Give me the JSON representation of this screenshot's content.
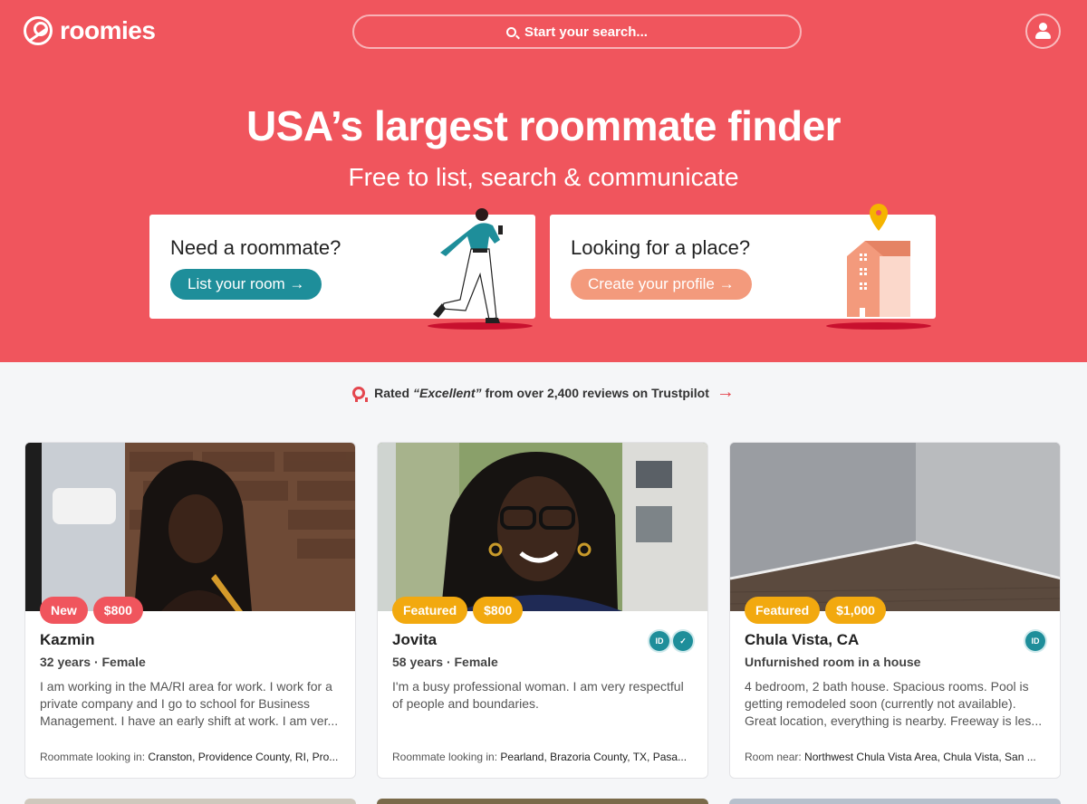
{
  "header": {
    "logo_text": "roomies",
    "search_placeholder": "Start your search..."
  },
  "hero": {
    "title": "USA’s largest roommate finder",
    "subtitle": "Free to list, search & communicate",
    "cta_room": {
      "title": "Need a roommate?",
      "button": "List your room →"
    },
    "cta_place": {
      "title": "Looking for a place?",
      "button": "Create your profile →"
    }
  },
  "trust": {
    "prefix": "Rated",
    "rating": "“Excellent”",
    "suffix": "from over 2,400 reviews on Trustpilot",
    "arrow": "→"
  },
  "cards": [
    {
      "badges": [
        "New",
        "$800"
      ],
      "name": "Kazmin",
      "meta": "32 years · Female",
      "description": "I am working in the MA/RI area for work. I work for a private company and I go to school for Business Management. I have an early shift at work. I am ver...",
      "foot_label": "Roommate looking in:",
      "foot_value": "Cranston, Providence County, RI, Pro..."
    },
    {
      "badges": [
        "Featured",
        "$800"
      ],
      "name": "Jovita",
      "meta": "58 years · Female",
      "description": "I'm a busy professional woman. I am very respectful of people and boundaries.",
      "foot_label": "Roommate looking in:",
      "foot_value": "Pearland, Brazoria County, TX, Pasa...",
      "verify": [
        "ID",
        "✓"
      ]
    },
    {
      "badges": [
        "Featured",
        "$1,000"
      ],
      "name": "Chula Vista, CA",
      "meta": "Unfurnished room in a house",
      "description": "4 bedroom, 2 bath house. Spacious rooms. Pool is getting remodeled soon (currently not available). Great location, everything is nearby. Freeway is les...",
      "foot_label": "Room near:",
      "foot_value": "Northwest Chula Vista Area, Chula Vista, San ...",
      "verify": [
        "ID"
      ]
    }
  ],
  "colors": {
    "brand": "#f0555d",
    "teal": "#1e8e9a",
    "peach": "#f39a7c",
    "gold": "#f2a90f"
  }
}
